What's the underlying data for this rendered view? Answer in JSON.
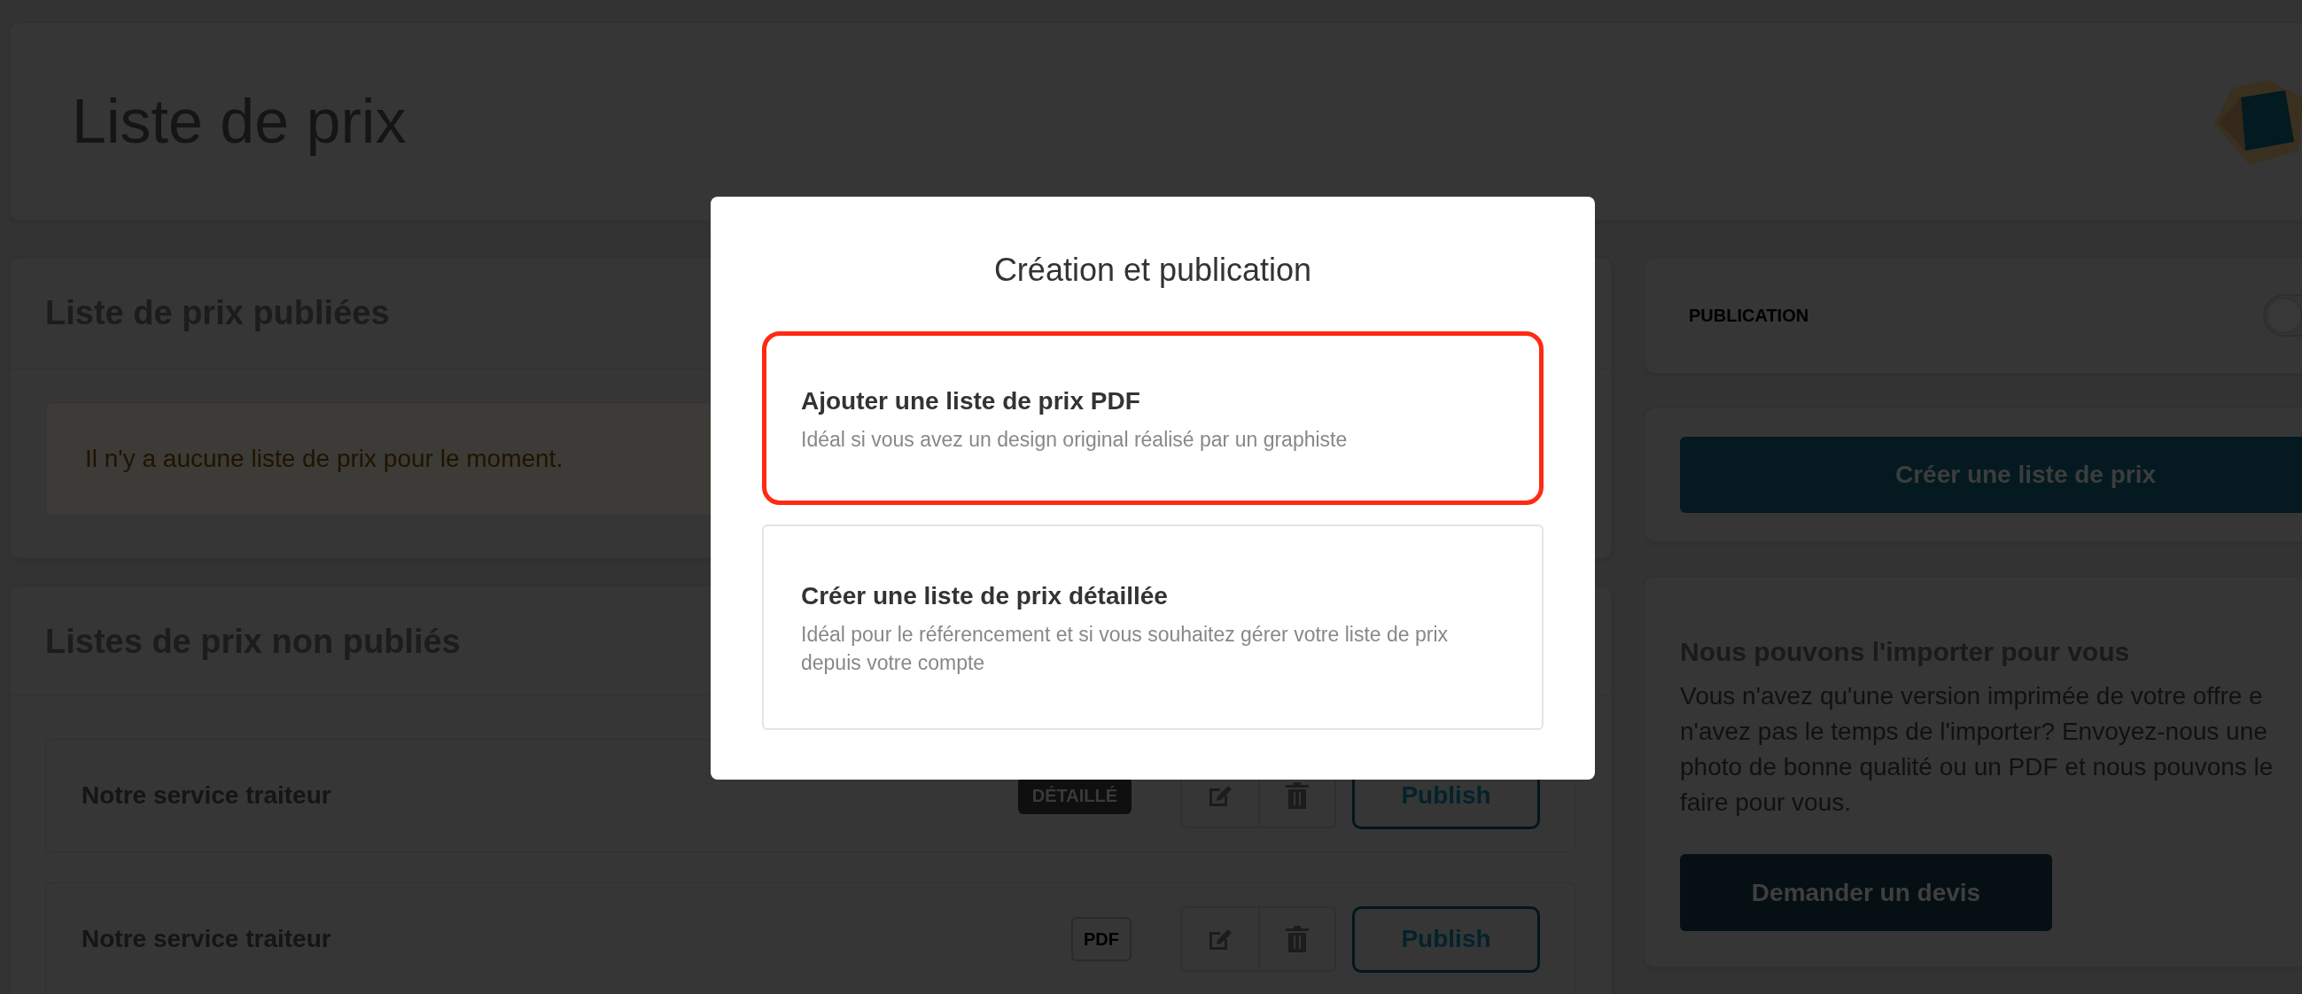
{
  "page": {
    "title": "Liste de prix"
  },
  "published": {
    "title": "Liste de prix publiées",
    "empty_message": "Il n'y a aucune liste de prix pour le moment."
  },
  "unpublished": {
    "title": "Listes de prix non publiés",
    "items": [
      {
        "name": "Notre service traiteur",
        "kind": "detailed",
        "badge": "DÉTAILLÉ",
        "action": "Publish"
      },
      {
        "name": "Notre service traiteur",
        "kind": "pdf",
        "badge": "PDF",
        "action": "Publish"
      }
    ]
  },
  "publication": {
    "label": "PUBLICATION",
    "on": false
  },
  "create_button": "Créer une liste de prix",
  "import": {
    "title": "Nous pouvons l'importer pour vous",
    "text_lines": [
      "Vous n'avez qu'une version imprimée de votre offre e",
      "n'avez pas le temps de l'importer? Envoyez-nous une",
      "photo de bonne qualité ou un PDF et nous pouvons le",
      "faire pour vous."
    ],
    "button": "Demander un devis"
  },
  "modal": {
    "title": "Création et publication",
    "options": [
      {
        "title": "Ajouter une liste de prix PDF",
        "description": "Idéal si vous avez un design original réalisé par un graphiste",
        "highlighted": true
      },
      {
        "title": "Créer une liste de prix détaillée",
        "description": "Idéal pour le référencement et si vous souhaitez gérer votre liste de prix depuis votre compte",
        "highlighted": false
      }
    ]
  }
}
